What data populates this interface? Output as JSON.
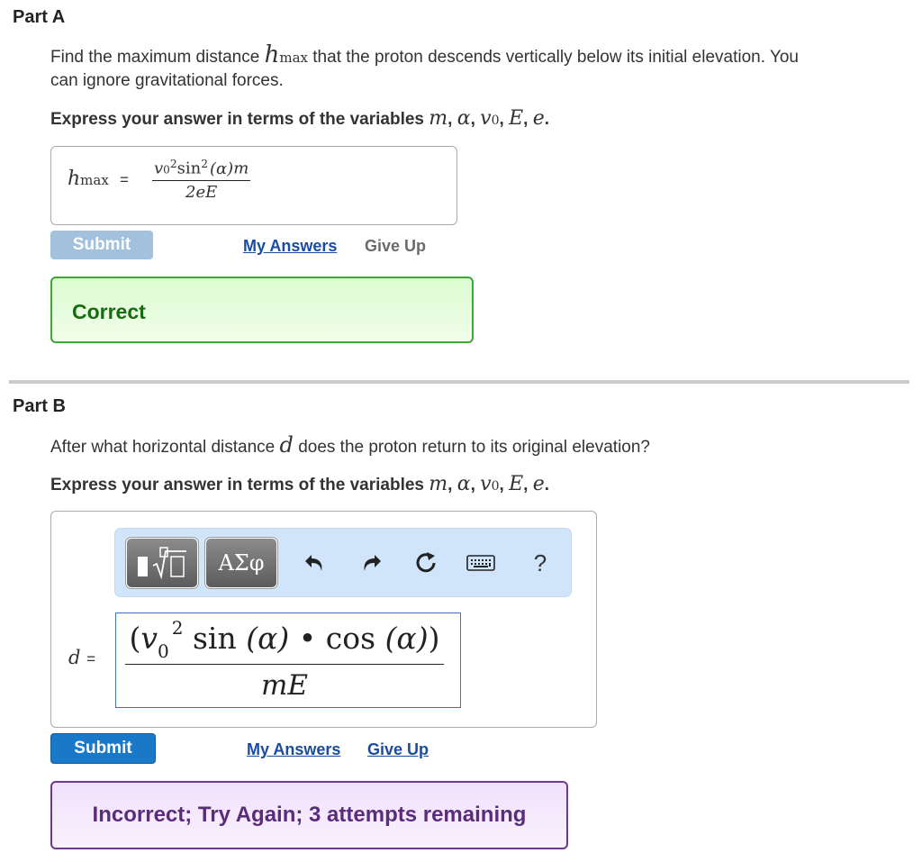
{
  "part_a": {
    "title": "Part A",
    "prompt_before": "Find the maximum distance",
    "prompt_var": "h",
    "prompt_var_sub": "max",
    "prompt_after": "that the proton descends vertically below its initial elevation. You",
    "prompt_line2": "can ignore gravitational forces.",
    "instruction": "Express your answer in terms of the variables",
    "variables": [
      "m",
      "α",
      "v",
      "E",
      "e"
    ],
    "variables_v_sub": "0",
    "answer": {
      "lhs_var": "h",
      "lhs_sub": "max",
      "equals": "=",
      "numerator_v": "v",
      "numerator_v_sub": "0",
      "numerator_pow": "2",
      "numerator_fn": "sin",
      "numerator_fn_pow": "2",
      "numerator_arg": "(α)",
      "numerator_tail": "m",
      "denominator": "2eE"
    },
    "submit_label": "Submit",
    "submit_state": "disabled",
    "my_answers_label": "My Answers",
    "give_up_label": "Give Up",
    "feedback": "Correct",
    "feedback_color": "#176b13"
  },
  "part_b": {
    "title": "Part B",
    "prompt_before": "After what horizontal distance",
    "prompt_var": "d",
    "prompt_after": "does the proton return to its original elevation?",
    "instruction": "Express your answer in terms of the variables",
    "variables": [
      "m",
      "α",
      "v",
      "E",
      "e"
    ],
    "variables_v_sub": "0",
    "toolbar": {
      "templates_icon": "fraction-root-template-icon",
      "symbols_label": "ΑΣφ",
      "undo_icon": "undo-icon",
      "redo_icon": "redo-icon",
      "reset_icon": "reset-icon",
      "keyboard_icon": "keyboard-icon",
      "help_label": "?"
    },
    "answer": {
      "lhs": "d",
      "equals": "=",
      "num_open": "(",
      "num_v": "v",
      "num_v_sub": "0",
      "num_pow": "2",
      "num_sin": "sin",
      "num_sin_arg": "(α)",
      "num_dot": "•",
      "num_cos": "cos",
      "num_cos_arg": "(α)",
      "num_close": ")",
      "denominator": "mE"
    },
    "submit_label": "Submit",
    "submit_state": "active",
    "my_answers_label": "My Answers",
    "give_up_label": "Give Up",
    "feedback": "Incorrect; Try Again; 3 attempts remaining",
    "feedback_color": "#5a2d7c"
  }
}
